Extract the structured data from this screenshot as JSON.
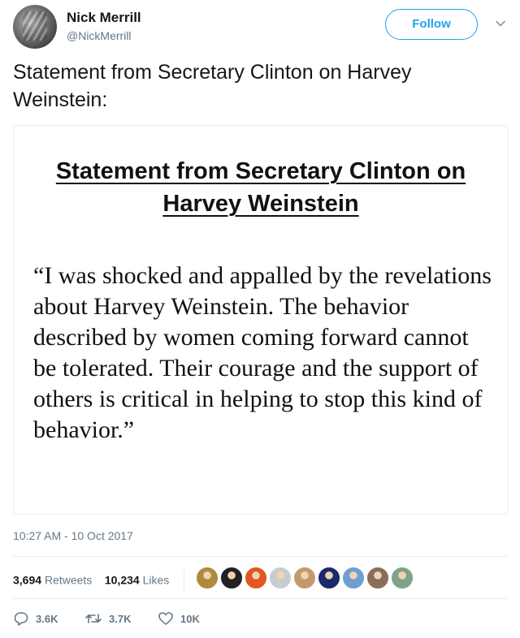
{
  "author": {
    "name": "Nick Merrill",
    "handle": "@NickMerrill",
    "follow_label": "Follow"
  },
  "tweet": {
    "text": "Statement from Secretary Clinton on Harvey Weinstein:",
    "timestamp": "10:27 AM - 10 Oct 2017"
  },
  "attachment": {
    "title_line1": "Statement from Secretary Clinton on",
    "title_line2": "Harvey Weinstein",
    "body": "“I was shocked and appalled by the revelations about Harvey Weinstein. The behavior described by women coming forward cannot be tolerated. Their courage and the support of others is critical in helping to stop this kind of behavior.”"
  },
  "stats": {
    "retweets_count": "3,694",
    "retweets_label": "Retweets",
    "likes_count": "10,234",
    "likes_label": "Likes"
  },
  "likers": [
    {
      "name": "liker-1",
      "color": "#b08a3c"
    },
    {
      "name": "liker-2",
      "color": "#222222"
    },
    {
      "name": "liker-3",
      "color": "#e4561f"
    },
    {
      "name": "liker-4",
      "color": "#c7ccd1"
    },
    {
      "name": "liker-5",
      "color": "#c49a6c"
    },
    {
      "name": "liker-6",
      "color": "#1b2a6b"
    },
    {
      "name": "liker-7",
      "color": "#6f9fd1"
    },
    {
      "name": "liker-8",
      "color": "#8a6e5a"
    },
    {
      "name": "liker-9",
      "color": "#7fa38a"
    }
  ],
  "actions": {
    "reply_count": "3.6K",
    "retweet_count": "3.7K",
    "like_count": "10K"
  },
  "colors": {
    "accent": "#1da1f2",
    "secondary_text": "#657786",
    "border": "#e6ecf0"
  }
}
